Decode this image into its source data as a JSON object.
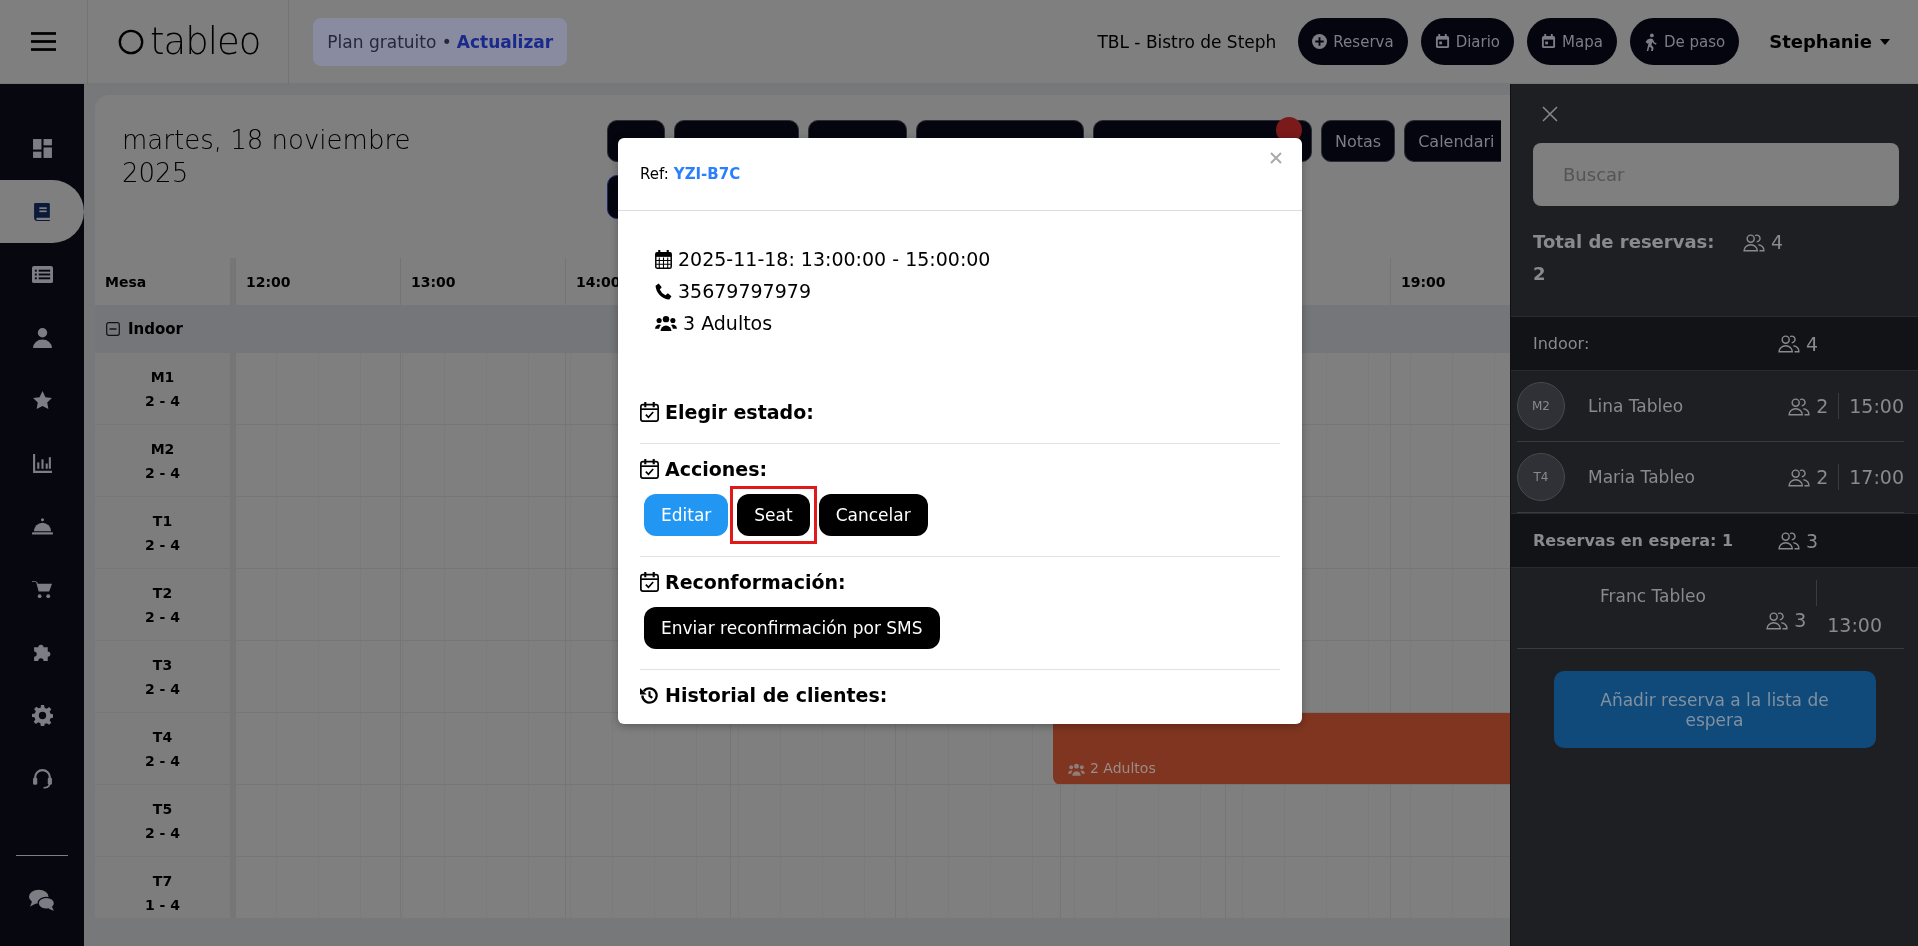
{
  "header": {
    "brand": "tableo",
    "plan": {
      "text": "Plan gratuito •",
      "link": "Actualizar"
    },
    "venue": "TBL - Bistro de Steph",
    "buttons": [
      {
        "label": "Reserva",
        "kind": "plus"
      },
      {
        "label": "Diario",
        "kind": "calendar"
      },
      {
        "label": "Mapa",
        "kind": "calendar"
      },
      {
        "label": "De paso",
        "kind": "walk"
      }
    ],
    "user": "Stephanie"
  },
  "sidebar": {
    "items": [
      {
        "kind": "dashboard",
        "selected": false
      },
      {
        "kind": "book",
        "selected": true
      },
      {
        "kind": "list",
        "selected": false
      },
      {
        "kind": "user",
        "selected": false
      },
      {
        "kind": "star",
        "selected": false
      },
      {
        "kind": "chart",
        "selected": false
      },
      {
        "kind": "bell",
        "selected": false
      },
      {
        "kind": "cart",
        "selected": false
      },
      {
        "kind": "puzzle",
        "selected": false
      },
      {
        "kind": "gear",
        "selected": false
      },
      {
        "kind": "headset",
        "selected": false
      }
    ],
    "footer_item": {
      "kind": "chat",
      "selected": false
    }
  },
  "main": {
    "date": "martes, 18 noviembre 2025",
    "tabs": [
      "Notas",
      "Calendari"
    ],
    "timeline": {
      "column_header": "Mesa",
      "hours_left": [
        "12:00",
        "13:00",
        "14:00"
      ],
      "hours_right": [
        "19:00"
      ],
      "group": {
        "label": "Indoor",
        "expanded": true
      },
      "tables": [
        {
          "name": "M1",
          "capacity": "2 - 4"
        },
        {
          "name": "M2",
          "capacity": "2 - 4"
        },
        {
          "name": "T1",
          "capacity": "2 - 4"
        },
        {
          "name": "T2",
          "capacity": "2 - 4"
        },
        {
          "name": "T3",
          "capacity": "2 - 4"
        },
        {
          "name": "T4",
          "capacity": "2 - 4",
          "bookings": [
            {
              "party": "2 Adultos"
            }
          ]
        },
        {
          "name": "T5",
          "capacity": "2 - 4"
        },
        {
          "name": "T7",
          "capacity": "1 - 4"
        }
      ]
    }
  },
  "panel": {
    "search_placeholder": "Buscar",
    "total": {
      "label": "Total de reservas: 2",
      "guests": "4"
    },
    "sections": [
      {
        "kind": "area",
        "title": "Indoor:",
        "guests": "4",
        "items": [
          {
            "table": "M2",
            "name": "Lina Tableo",
            "guests": "2",
            "time": "15:00"
          },
          {
            "table": "T4",
            "name": "Maria Tableo",
            "guests": "2",
            "time": "17:00"
          }
        ]
      },
      {
        "kind": "waitlist",
        "title": "Reservas en espera: 1",
        "guests": "3",
        "items": [
          {
            "name": "Franc Tableo",
            "guests": "3",
            "time": "13:00"
          }
        ]
      }
    ],
    "waitlist_button": "Añadir reserva a la lista de espera"
  },
  "modal": {
    "ref_label": "Ref:",
    "ref": "YZI-B7C",
    "details": [
      {
        "kind": "date",
        "text": "2025-11-18: 13:00:00 - 15:00:00"
      },
      {
        "kind": "phone",
        "text": "35679797979"
      },
      {
        "kind": "party",
        "text": "3 Adultos"
      }
    ],
    "sections": [
      {
        "kind": "status",
        "title": "Elegir estado:"
      },
      {
        "kind": "actions",
        "title": "Acciones:",
        "buttons": [
          {
            "label": "Editar",
            "kind": "primary",
            "highlighted": false
          },
          {
            "label": "Seat",
            "kind": "dark",
            "highlighted": true
          },
          {
            "label": "Cancelar",
            "kind": "dark",
            "highlighted": false
          }
        ]
      },
      {
        "kind": "reconfirm",
        "title": "Reconformación:",
        "buttons": [
          {
            "label": "Enviar reconfirmación por SMS",
            "kind": "dark",
            "highlighted": false
          }
        ]
      },
      {
        "kind": "history",
        "title": "Historial de clientes:"
      }
    ]
  }
}
